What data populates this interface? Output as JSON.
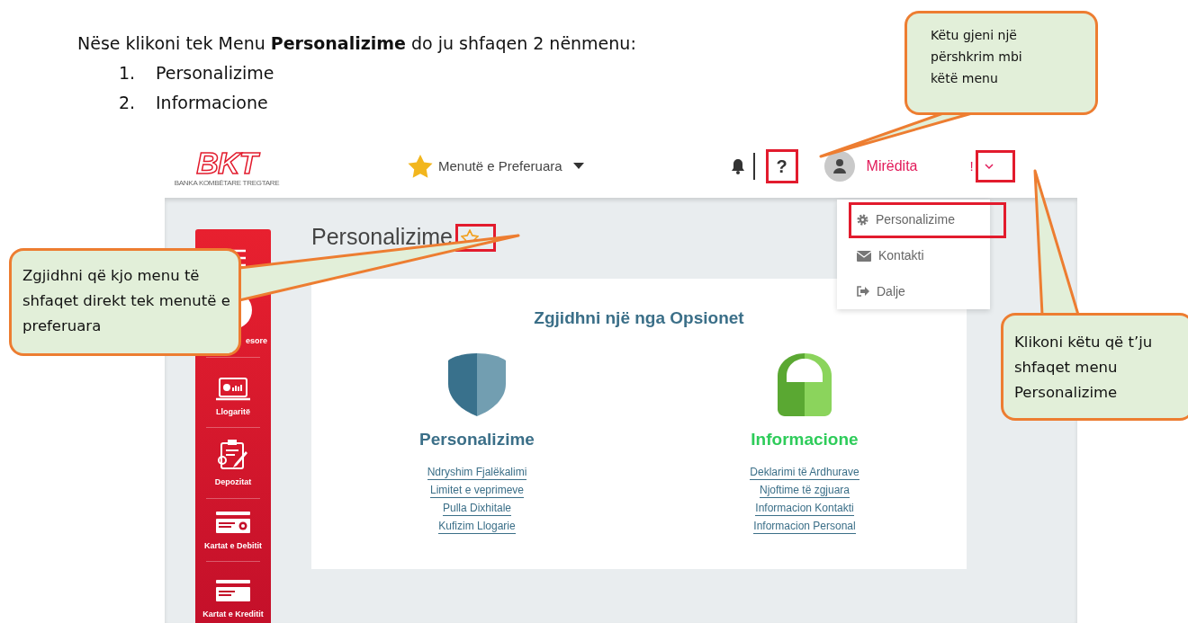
{
  "intro": {
    "text": "Nëse klikoni tek Menu **Personalizime** do ju shfaqen 2 nënmenu:",
    "list": [
      {
        "number": "1.",
        "text": "Personalizime"
      },
      {
        "number": "2.",
        "text": "Informacione"
      }
    ]
  },
  "app": {
    "logo": {
      "mark": "BKT",
      "subtitle": "BANKA KOMBËTARE TREGTARE"
    },
    "favorites": {
      "label": "Menutë e Preferuara"
    },
    "help": {
      "label": "?",
      "highlighted": true
    },
    "greeting": "Mirëdita",
    "greeting_mark": "!",
    "user_menu_toggle": {
      "highlighted": true
    },
    "dropdown": [
      {
        "label": "Personalizime",
        "highlighted": true
      },
      {
        "label": "Kontakti",
        "highlighted": false
      },
      {
        "label": "Dalje",
        "highlighted": false
      }
    ],
    "sidebar": {
      "items": [
        {
          "label": "esore"
        },
        {
          "label": "Llogaritë"
        },
        {
          "label": "Depozitat"
        },
        {
          "label": "Kartat e Debitit"
        },
        {
          "label": "Kartat e Kreditit"
        }
      ]
    },
    "page_title": "Personalizime",
    "favorite_star": {
      "highlighted": true
    },
    "card": {
      "heading": "Zgjidhni një nga Opsionet",
      "sections": [
        {
          "title": "Personalizime",
          "kind": "shield",
          "links": [
            "Ndryshim Fjalëkalimi",
            "Limitet e veprimeve",
            "Pulla Dixhitale",
            "Kufizim Llogarie"
          ]
        },
        {
          "title": "Informacione",
          "kind": "lock",
          "links": [
            "Deklarimi të Ardhurave",
            "Njoftime të zgjuara",
            "Informacion Kontakti",
            "Informacion Personal"
          ]
        }
      ]
    }
  },
  "callouts": [
    {
      "text": "Këtu gjeni një përshkrim mbi këtë menu"
    },
    {
      "text": "Zgjidhni që kjo menu të shfaqet direkt tek menutë e preferuara"
    },
    {
      "text": "Klikoni këtu që t’ju shfaqet menu Personalizime"
    }
  ]
}
